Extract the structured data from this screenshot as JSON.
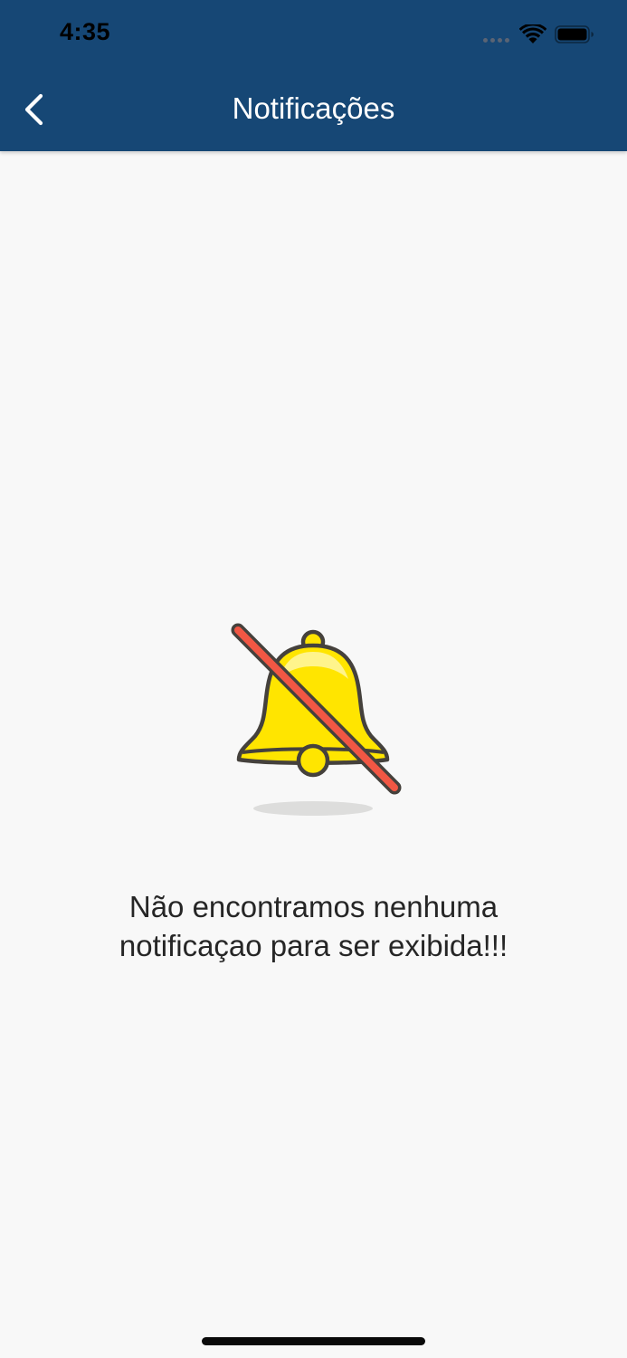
{
  "status_bar": {
    "time": "4:35",
    "signal_icon": "cellular-signal-icon",
    "wifi_icon": "wifi-icon",
    "battery_icon": "battery-icon"
  },
  "header": {
    "title": "Notificações",
    "back_icon": "chevron-left-icon",
    "background_color": "#164775"
  },
  "empty_state": {
    "icon": "bell-muted-icon",
    "message_line1": "Não encontramos nenhuma",
    "message_line2": "notificaçao para ser exibida!!!"
  },
  "colors": {
    "bell_fill": "#FFE500",
    "bell_outline": "#45413C",
    "slash": "#F15744",
    "page_background": "#F8F8F8"
  }
}
